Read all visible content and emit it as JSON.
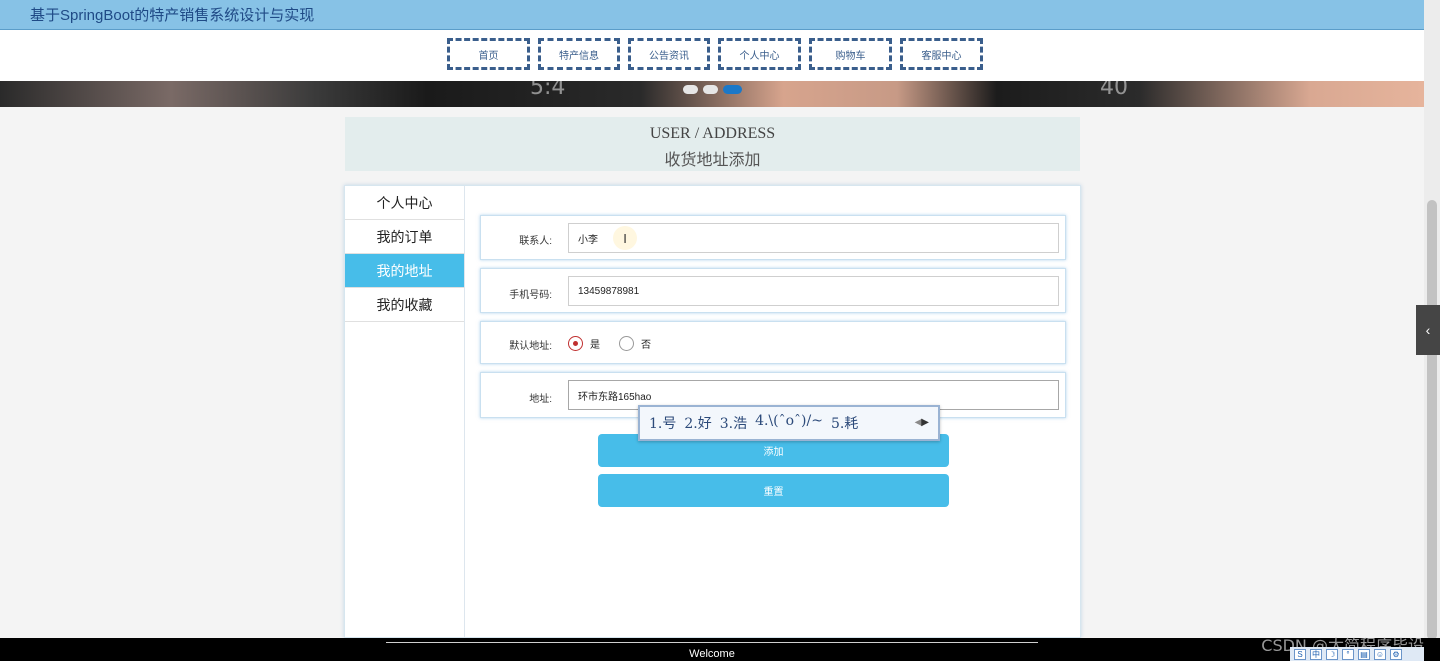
{
  "site": {
    "title": "基于SpringBoot的特产销售系统设计与实现"
  },
  "nav": [
    {
      "label": "首页"
    },
    {
      "label": "特产信息"
    },
    {
      "label": "公告资讯"
    },
    {
      "label": "个人中心"
    },
    {
      "label": "购物车"
    },
    {
      "label": "客服中心"
    }
  ],
  "carousel": {
    "slide_count": 3,
    "active_index": 2
  },
  "heading": {
    "en": "USER / ADDRESS",
    "cn": "收货地址添加"
  },
  "menu": [
    {
      "label": "个人中心",
      "active": false
    },
    {
      "label": "我的订单",
      "active": false
    },
    {
      "label": "我的地址",
      "active": true
    },
    {
      "label": "我的收藏",
      "active": false
    }
  ],
  "form": {
    "contact": {
      "label": "联系人:",
      "value": "小李"
    },
    "phone": {
      "label": "手机号码:",
      "value": "13459878981"
    },
    "default": {
      "label": "默认地址:",
      "options": [
        "是",
        "否"
      ],
      "selected": "是"
    },
    "address": {
      "label": "地址:",
      "value": "环市东路165hao"
    },
    "add_button": "添加",
    "reset_button": "重置"
  },
  "ime": {
    "candidates": [
      "1.号",
      "2.好",
      "3.浩",
      "4.\\(ˆoˆ)/~",
      "5.耗"
    ]
  },
  "footer": {
    "welcome": "Welcome"
  },
  "watermark": "CSDN @太简程序毕设",
  "colors": {
    "accent": "#47bde9",
    "topbar": "#87c2e6",
    "nav_border": "#3a5e8c"
  }
}
